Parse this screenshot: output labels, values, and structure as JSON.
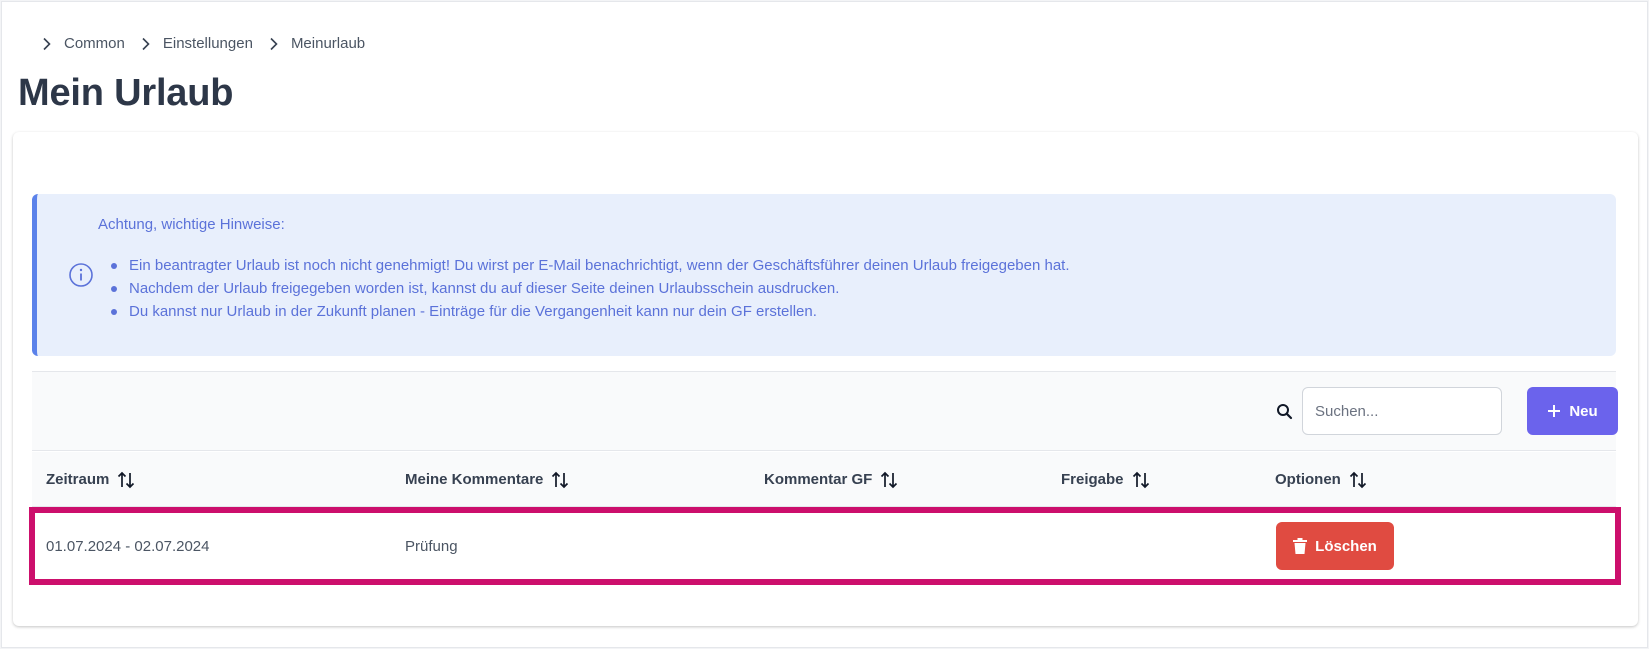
{
  "breadcrumb": {
    "items": [
      {
        "label": "Common"
      },
      {
        "label": "Einstellungen"
      },
      {
        "label": "Meinurlaub"
      }
    ]
  },
  "page": {
    "title": "Mein Urlaub"
  },
  "notice": {
    "icon": "info-circle-icon",
    "title": "Achtung, wichtige Hinweise:",
    "items": [
      "Ein beantragter Urlaub ist noch nicht genehmigt! Du wirst per E-Mail benachrichtigt, wenn der Geschäftsführer deinen Urlaub freigegeben hat.",
      "Nachdem der Urlaub freigegeben worden ist, kannst du auf dieser Seite deinen Urlaubsschein ausdrucken.",
      "Du kannst nur Urlaub in der Zukunft planen - Einträge für die Vergangenheit kann nur dein GF erstellen."
    ]
  },
  "toolbar": {
    "search_placeholder": "Suchen...",
    "search_value": "",
    "new_label": "Neu"
  },
  "table": {
    "columns": [
      "Zeitraum",
      "Meine Kommentare",
      "Kommentar GF",
      "Freigabe",
      "Optionen"
    ],
    "rows": [
      {
        "zeitraum": "01.07.2024 - 02.07.2024",
        "meine_kommentare": "Prüfung",
        "kommentar_gf": "",
        "freigabe": "",
        "delete_label": "Löschen"
      }
    ]
  },
  "colors": {
    "primary": "#6b63ec",
    "danger": "#e04b41",
    "info_bg": "#e8effc",
    "info_accent": "#5b82ea",
    "highlight": "#cc0f6c"
  }
}
